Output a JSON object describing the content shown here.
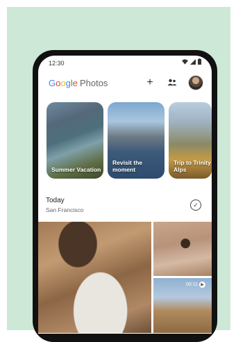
{
  "status_bar": {
    "time": "12:30"
  },
  "app_bar": {
    "logo_google": [
      "G",
      "o",
      "o",
      "g",
      "l",
      "e"
    ],
    "logo_photos": "Photos",
    "add_icon": "+",
    "sharing_icon": "people-icon"
  },
  "memories": [
    {
      "title": "Summer Vacation"
    },
    {
      "title": "Revisit the moment"
    },
    {
      "title": "Trip to Trinity Alps"
    }
  ],
  "section": {
    "title": "Today",
    "subtitle": "San Francisco"
  },
  "video": {
    "duration": "00:11"
  },
  "colors": {
    "background": "#cde8d6",
    "phone_frame": "#111111"
  }
}
